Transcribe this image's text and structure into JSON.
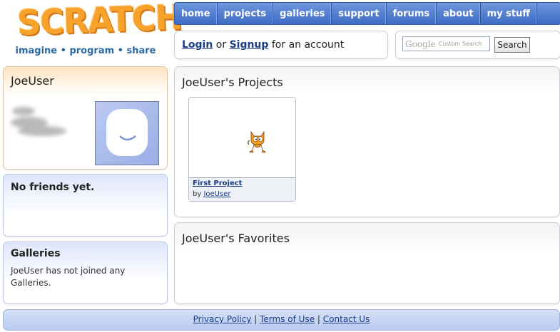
{
  "brand": {
    "logo_text": "SCRATCH",
    "tagline": "imagine • program • share"
  },
  "nav": {
    "items": [
      {
        "label": "home"
      },
      {
        "label": "projects"
      },
      {
        "label": "galleries"
      },
      {
        "label": "support"
      },
      {
        "label": "forums"
      },
      {
        "label": "about"
      },
      {
        "label": "my stuff"
      }
    ]
  },
  "login": {
    "login_label": "Login",
    "or_text": "or",
    "signup_label": "Signup",
    "suffix": "for an account"
  },
  "search": {
    "google_mark": "Google",
    "placeholder": "Custom Search",
    "button_label": "Search"
  },
  "profile": {
    "username": "JoeUser"
  },
  "friends": {
    "title": "No friends yet."
  },
  "galleries": {
    "title": "Galleries",
    "text": "JoeUser has not joined any Galleries."
  },
  "projects": {
    "title": "JoeUser's Projects",
    "items": [
      {
        "title": "First Project",
        "by_label": "by",
        "author": "JoeUser"
      }
    ]
  },
  "favorites": {
    "title": "JoeUser's Favorites"
  },
  "footer": {
    "links": [
      "Privacy Policy",
      "Terms of Use",
      "Contact Us"
    ],
    "separator": "|"
  },
  "colors": {
    "nav_blue": "#3d6bc4",
    "link_blue": "#1b3d86",
    "logo_orange": "#f7a22a",
    "tagline_blue": "#2c6aa4"
  }
}
